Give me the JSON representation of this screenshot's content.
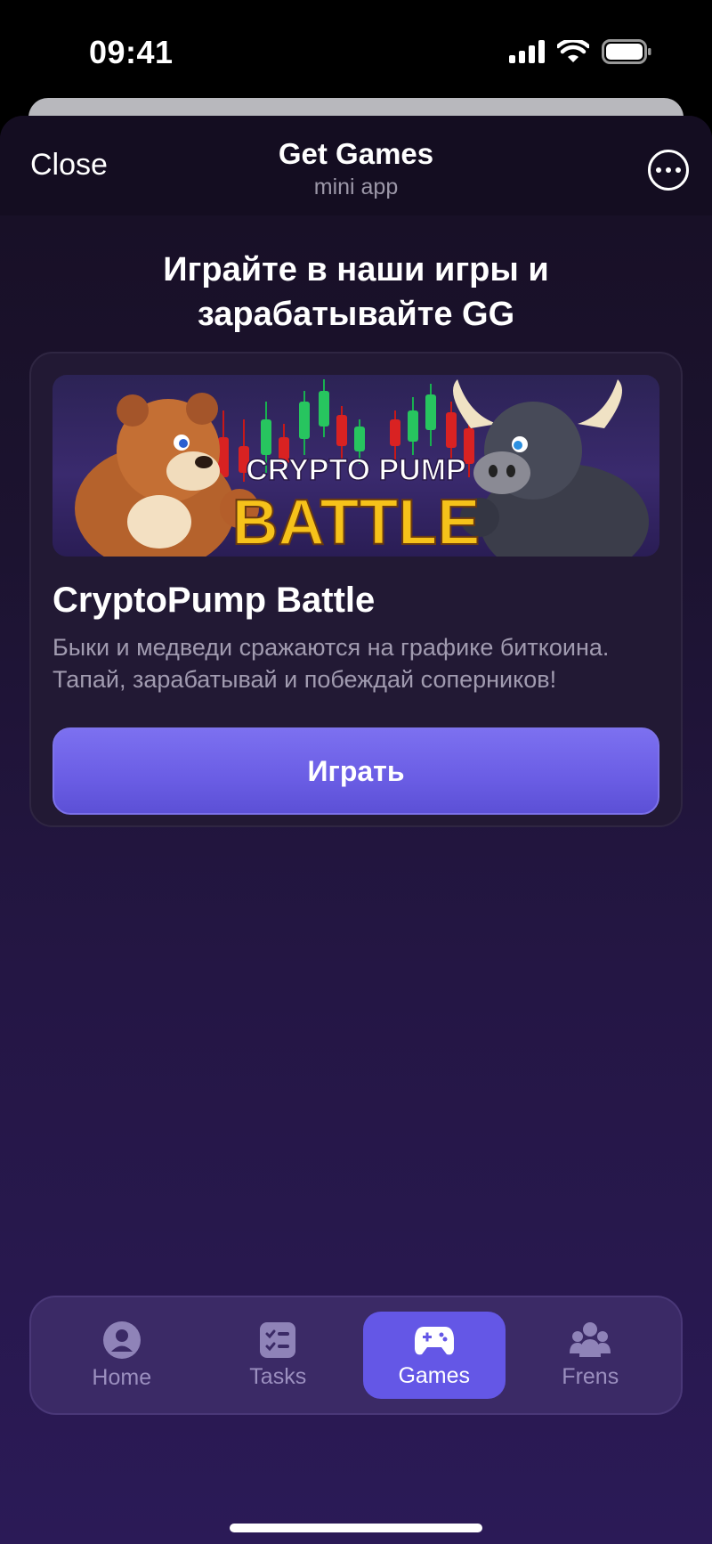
{
  "status_bar": {
    "time": "09:41"
  },
  "header": {
    "close_label": "Close",
    "title": "Get Games",
    "subtitle": "mini app"
  },
  "headline": {
    "line1": "Играйте в наши игры и",
    "line2": "зарабатывайте GG"
  },
  "game": {
    "banner_text_top": "CRYPTO PUMP",
    "banner_text_bottom": "BATTLE",
    "title": "CryptoPump Battle",
    "description": "Быки и медведи сражаются на графике биткоина. Тапай, зарабатывай и побеждай соперников!",
    "play_label": "Играть"
  },
  "tabs": [
    {
      "label": "Home",
      "icon": "user-icon",
      "active": false
    },
    {
      "label": "Tasks",
      "icon": "tasks-icon",
      "active": false
    },
    {
      "label": "Games",
      "icon": "gamepad-icon",
      "active": true
    },
    {
      "label": "Frens",
      "icon": "friends-icon",
      "active": false
    }
  ],
  "colors": {
    "accent": "#6457e6",
    "background": "#1c1330",
    "card": "#221934"
  }
}
